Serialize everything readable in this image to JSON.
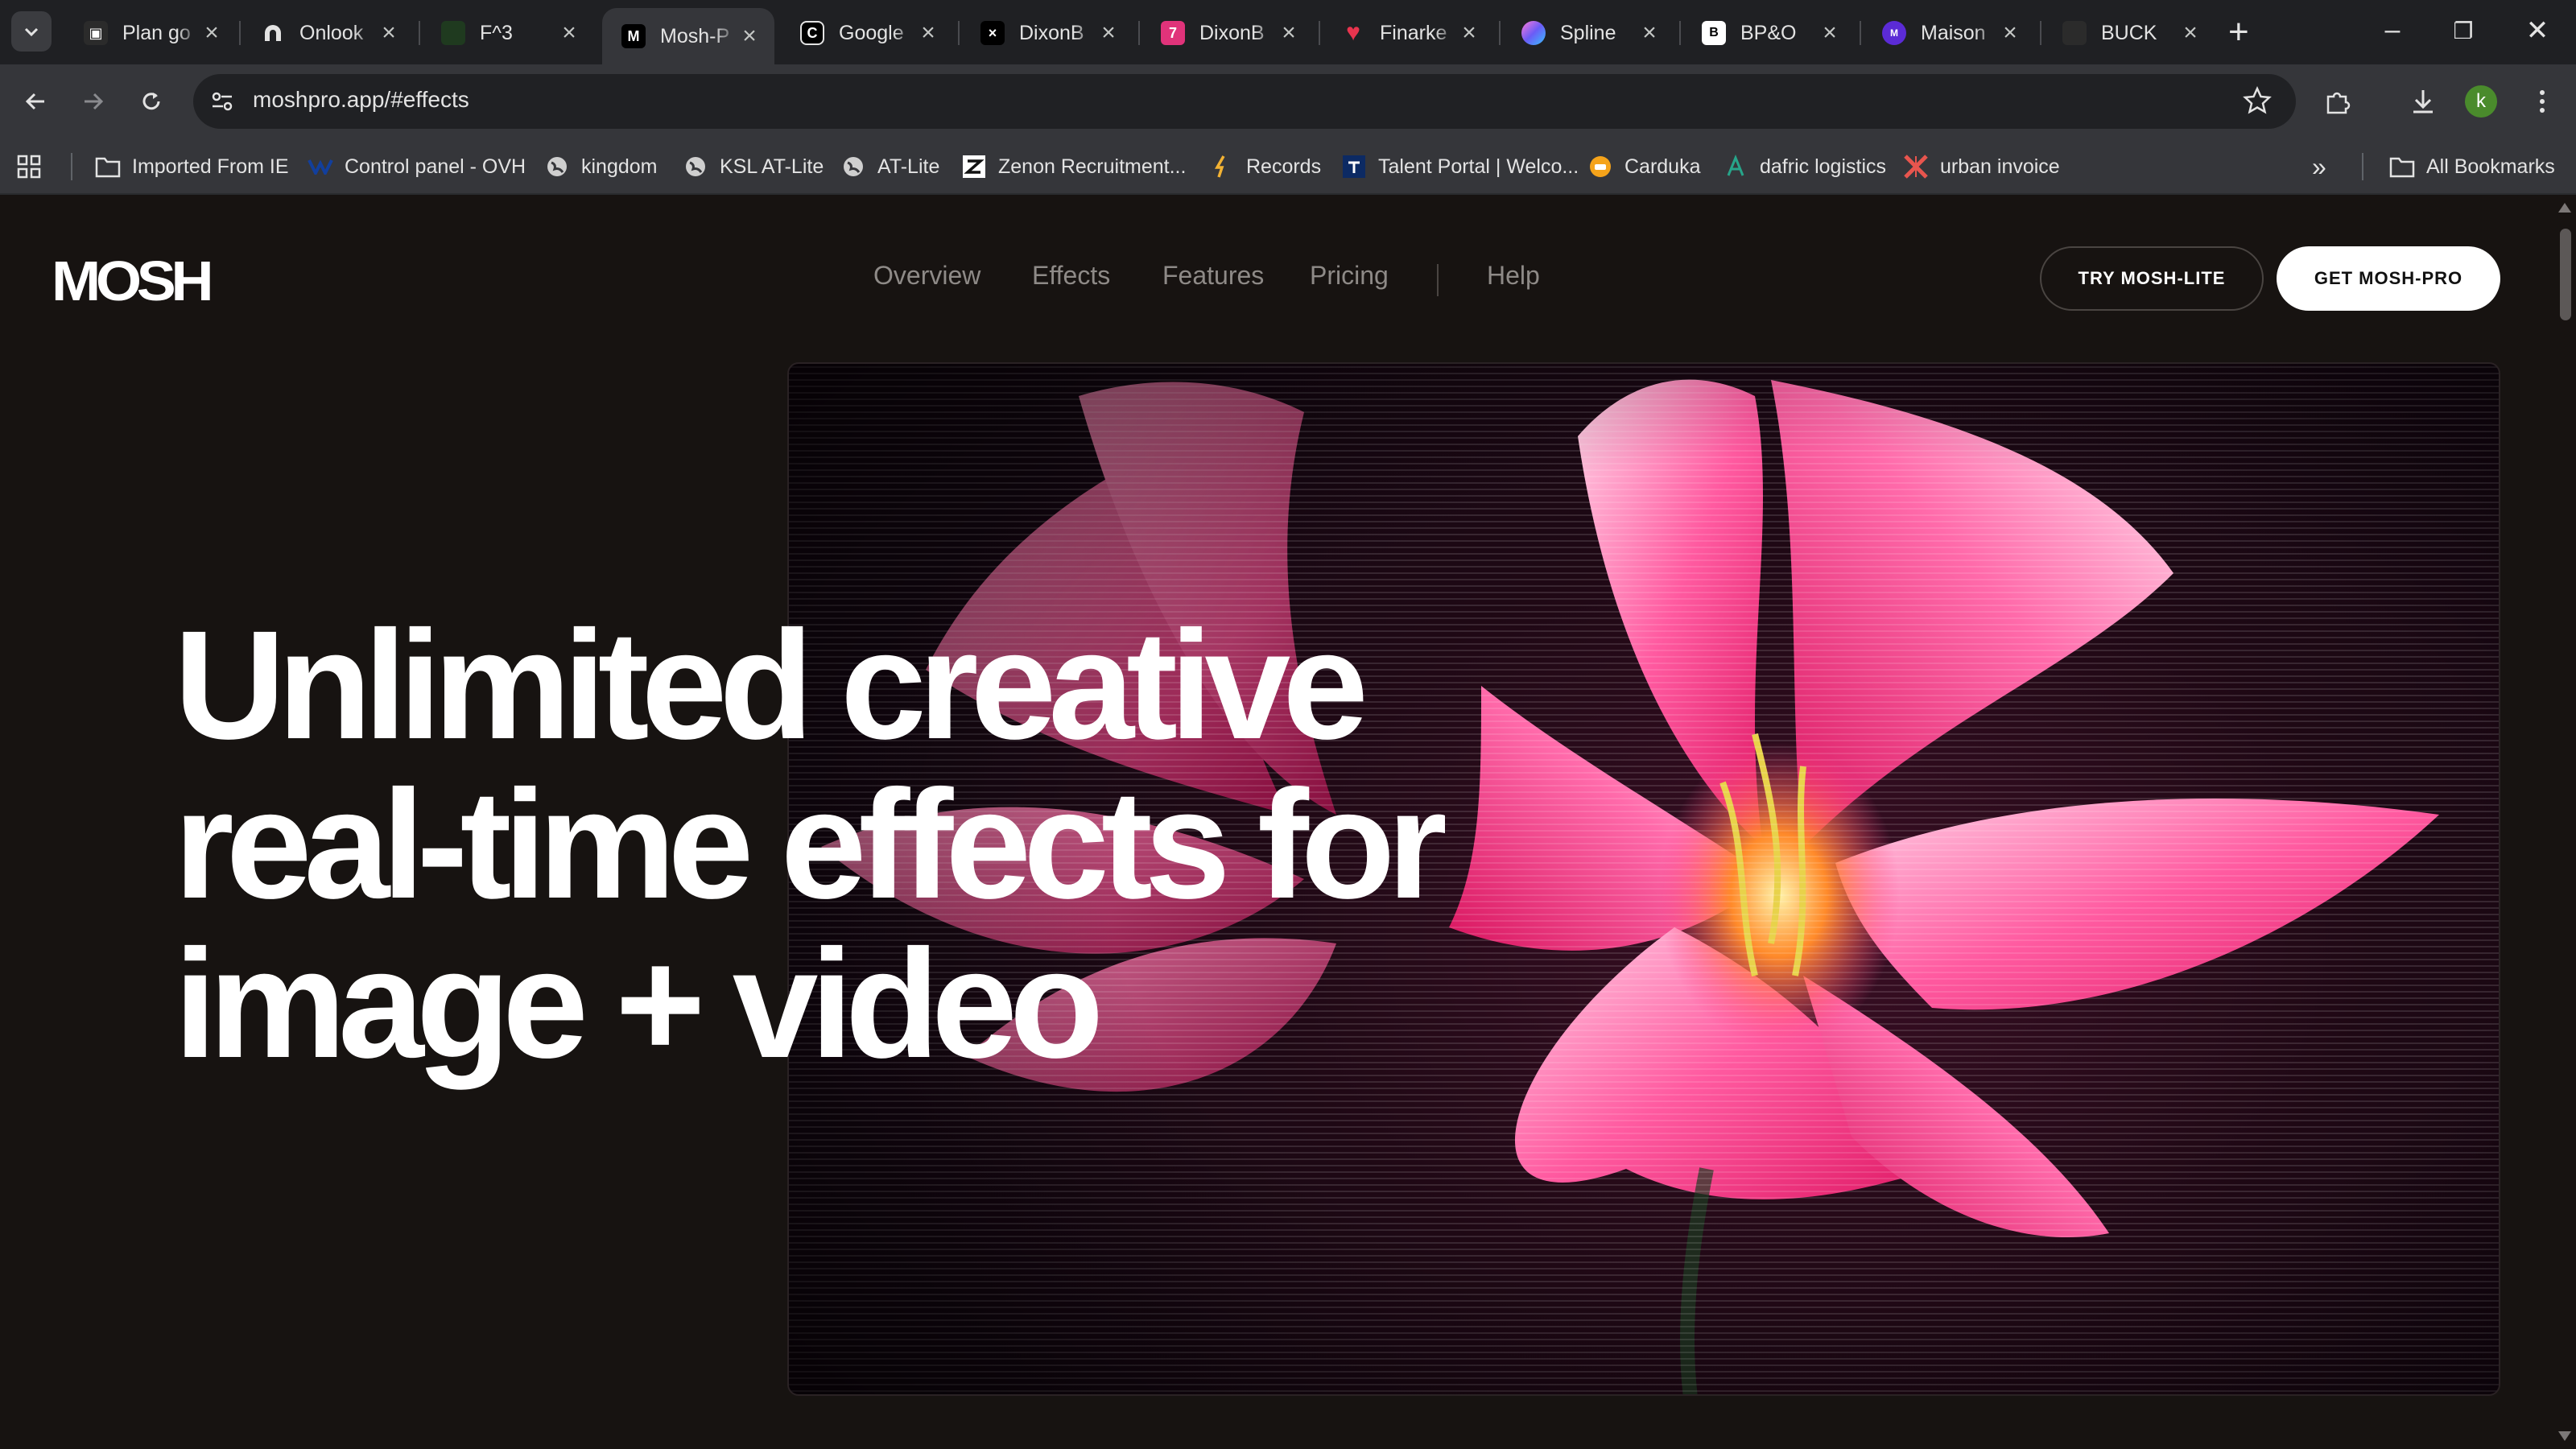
{
  "browser": {
    "tabs": [
      {
        "title": "Plan go",
        "icon": "box-logo-icon",
        "color": "#2b2b2b"
      },
      {
        "title": "Onlook",
        "icon": "onlook-logo-icon",
        "color": "#2b2b2b"
      },
      {
        "title": "F^3",
        "icon": "f3-logo-icon",
        "color": "#1f3a1f"
      },
      {
        "title": "Mosh-P",
        "icon": "mosh-m-icon",
        "color": "#000000"
      },
      {
        "title": "Google",
        "icon": "google-c-icon",
        "color": "#000000"
      },
      {
        "title": "DixonB",
        "icon": "dixon-x-icon",
        "color": "#000000"
      },
      {
        "title": "DixonB",
        "icon": "dixon-pink-icon",
        "color": "#e0337a"
      },
      {
        "title": "Finarke",
        "icon": "heart-icon",
        "color": "#e8344e"
      },
      {
        "title": "Spline",
        "icon": "spline-orb-icon",
        "color": "#6b5cf6"
      },
      {
        "title": "BP&O",
        "icon": "bpo-logo-icon",
        "color": "#ffffff"
      },
      {
        "title": "Maison",
        "icon": "maison-logo-icon",
        "color": "#5b2bd6"
      },
      {
        "title": "BUCK",
        "icon": "buck-logo-icon",
        "color": "#2b2b2b"
      }
    ],
    "active_tab_index": 3,
    "url": "moshpro.app/#effects",
    "profile_initial": "k",
    "bookmarks": [
      {
        "label": "Imported From IE",
        "icon": "folder-icon"
      },
      {
        "label": "Control panel - OVH",
        "icon": "ovh-logo-icon"
      },
      {
        "label": "kingdom",
        "icon": "globe-icon"
      },
      {
        "label": "KSL AT-Lite",
        "icon": "globe-icon"
      },
      {
        "label": "AT-Lite",
        "icon": "globe-icon"
      },
      {
        "label": "Zenon Recruitment...",
        "icon": "zenon-z-icon"
      },
      {
        "label": "Records",
        "icon": "records-logo-icon"
      },
      {
        "label": "Talent Portal | Welco...",
        "icon": "talent-portal-icon"
      },
      {
        "label": "Carduka",
        "icon": "carduka-logo-icon"
      },
      {
        "label": "dafric logistics",
        "icon": "dafric-logo-icon"
      },
      {
        "label": "urban invoice",
        "icon": "urban-invoice-icon"
      }
    ],
    "all_bookmarks_label": "All Bookmarks"
  },
  "site": {
    "logo": "MOSH",
    "nav": [
      "Overview",
      "Effects",
      "Features",
      "Pricing"
    ],
    "help": "Help",
    "cta_lite": "TRY MOSH-LITE",
    "cta_pro": "GET MOSH-PRO",
    "hero_lines": [
      "Unlimited creative",
      "real-time effects for",
      "image + video"
    ]
  },
  "colors": {
    "page_bg": "#171311",
    "accent_pink": "#ff3d8a",
    "button_bg": "#ffffff"
  }
}
